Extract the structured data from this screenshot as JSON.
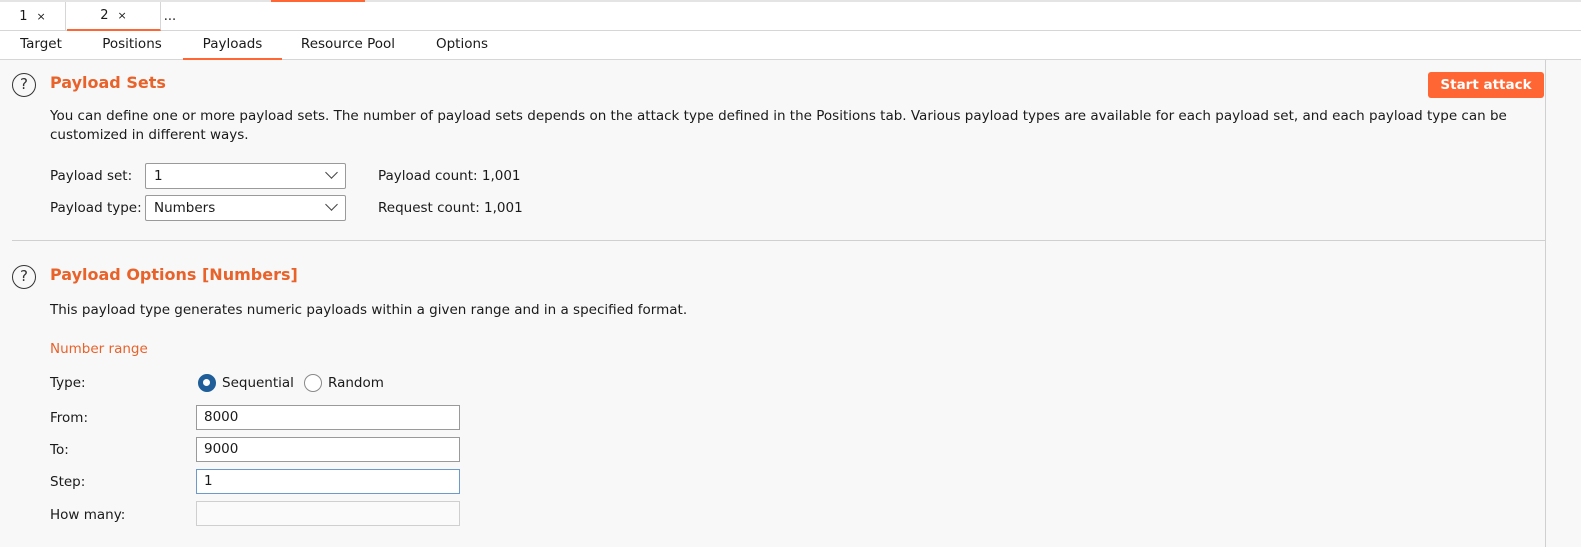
{
  "request_tabs": [
    {
      "label": "1",
      "close": "×"
    },
    {
      "label": "2",
      "close": "×"
    },
    {
      "label": "..."
    }
  ],
  "sub_tabs": [
    {
      "label": "Target"
    },
    {
      "label": "Positions"
    },
    {
      "label": "Payloads",
      "active": true
    },
    {
      "label": "Resource Pool"
    },
    {
      "label": "Options"
    }
  ],
  "payload_sets": {
    "title": "Payload Sets",
    "start_attack": "Start attack",
    "description_line1": "You can define one or more payload sets. The number of payload sets depends on the attack type defined in the Positions tab. Various payload types are available for each payload set, and each payload type can be",
    "description_line2": "customized in different ways.",
    "payload_set_label": "Payload set:",
    "payload_set_value": "1",
    "payload_type_label": "Payload type:",
    "payload_type_value": "Numbers",
    "payload_count": "Payload count: 1,001",
    "request_count": "Request count: 1,001"
  },
  "payload_options": {
    "title": "Payload Options [Numbers]",
    "description": "This payload type generates numeric payloads within a given range and in a specified format.",
    "number_range_label": "Number range",
    "type_label": "Type:",
    "sequential_label": "Sequential",
    "random_label": "Random",
    "selected_type": "Sequential",
    "from_label": "From:",
    "from_value": "8000",
    "to_label": "To:",
    "to_value": "9000",
    "step_label": "Step:",
    "step_value": "1",
    "how_many_label": "How many:",
    "how_many_value": ""
  },
  "icons": {
    "help": "?"
  },
  "colors": {
    "accent": "#ff6633",
    "title": "#e8622a",
    "radio_selected": "#1f5e99"
  }
}
